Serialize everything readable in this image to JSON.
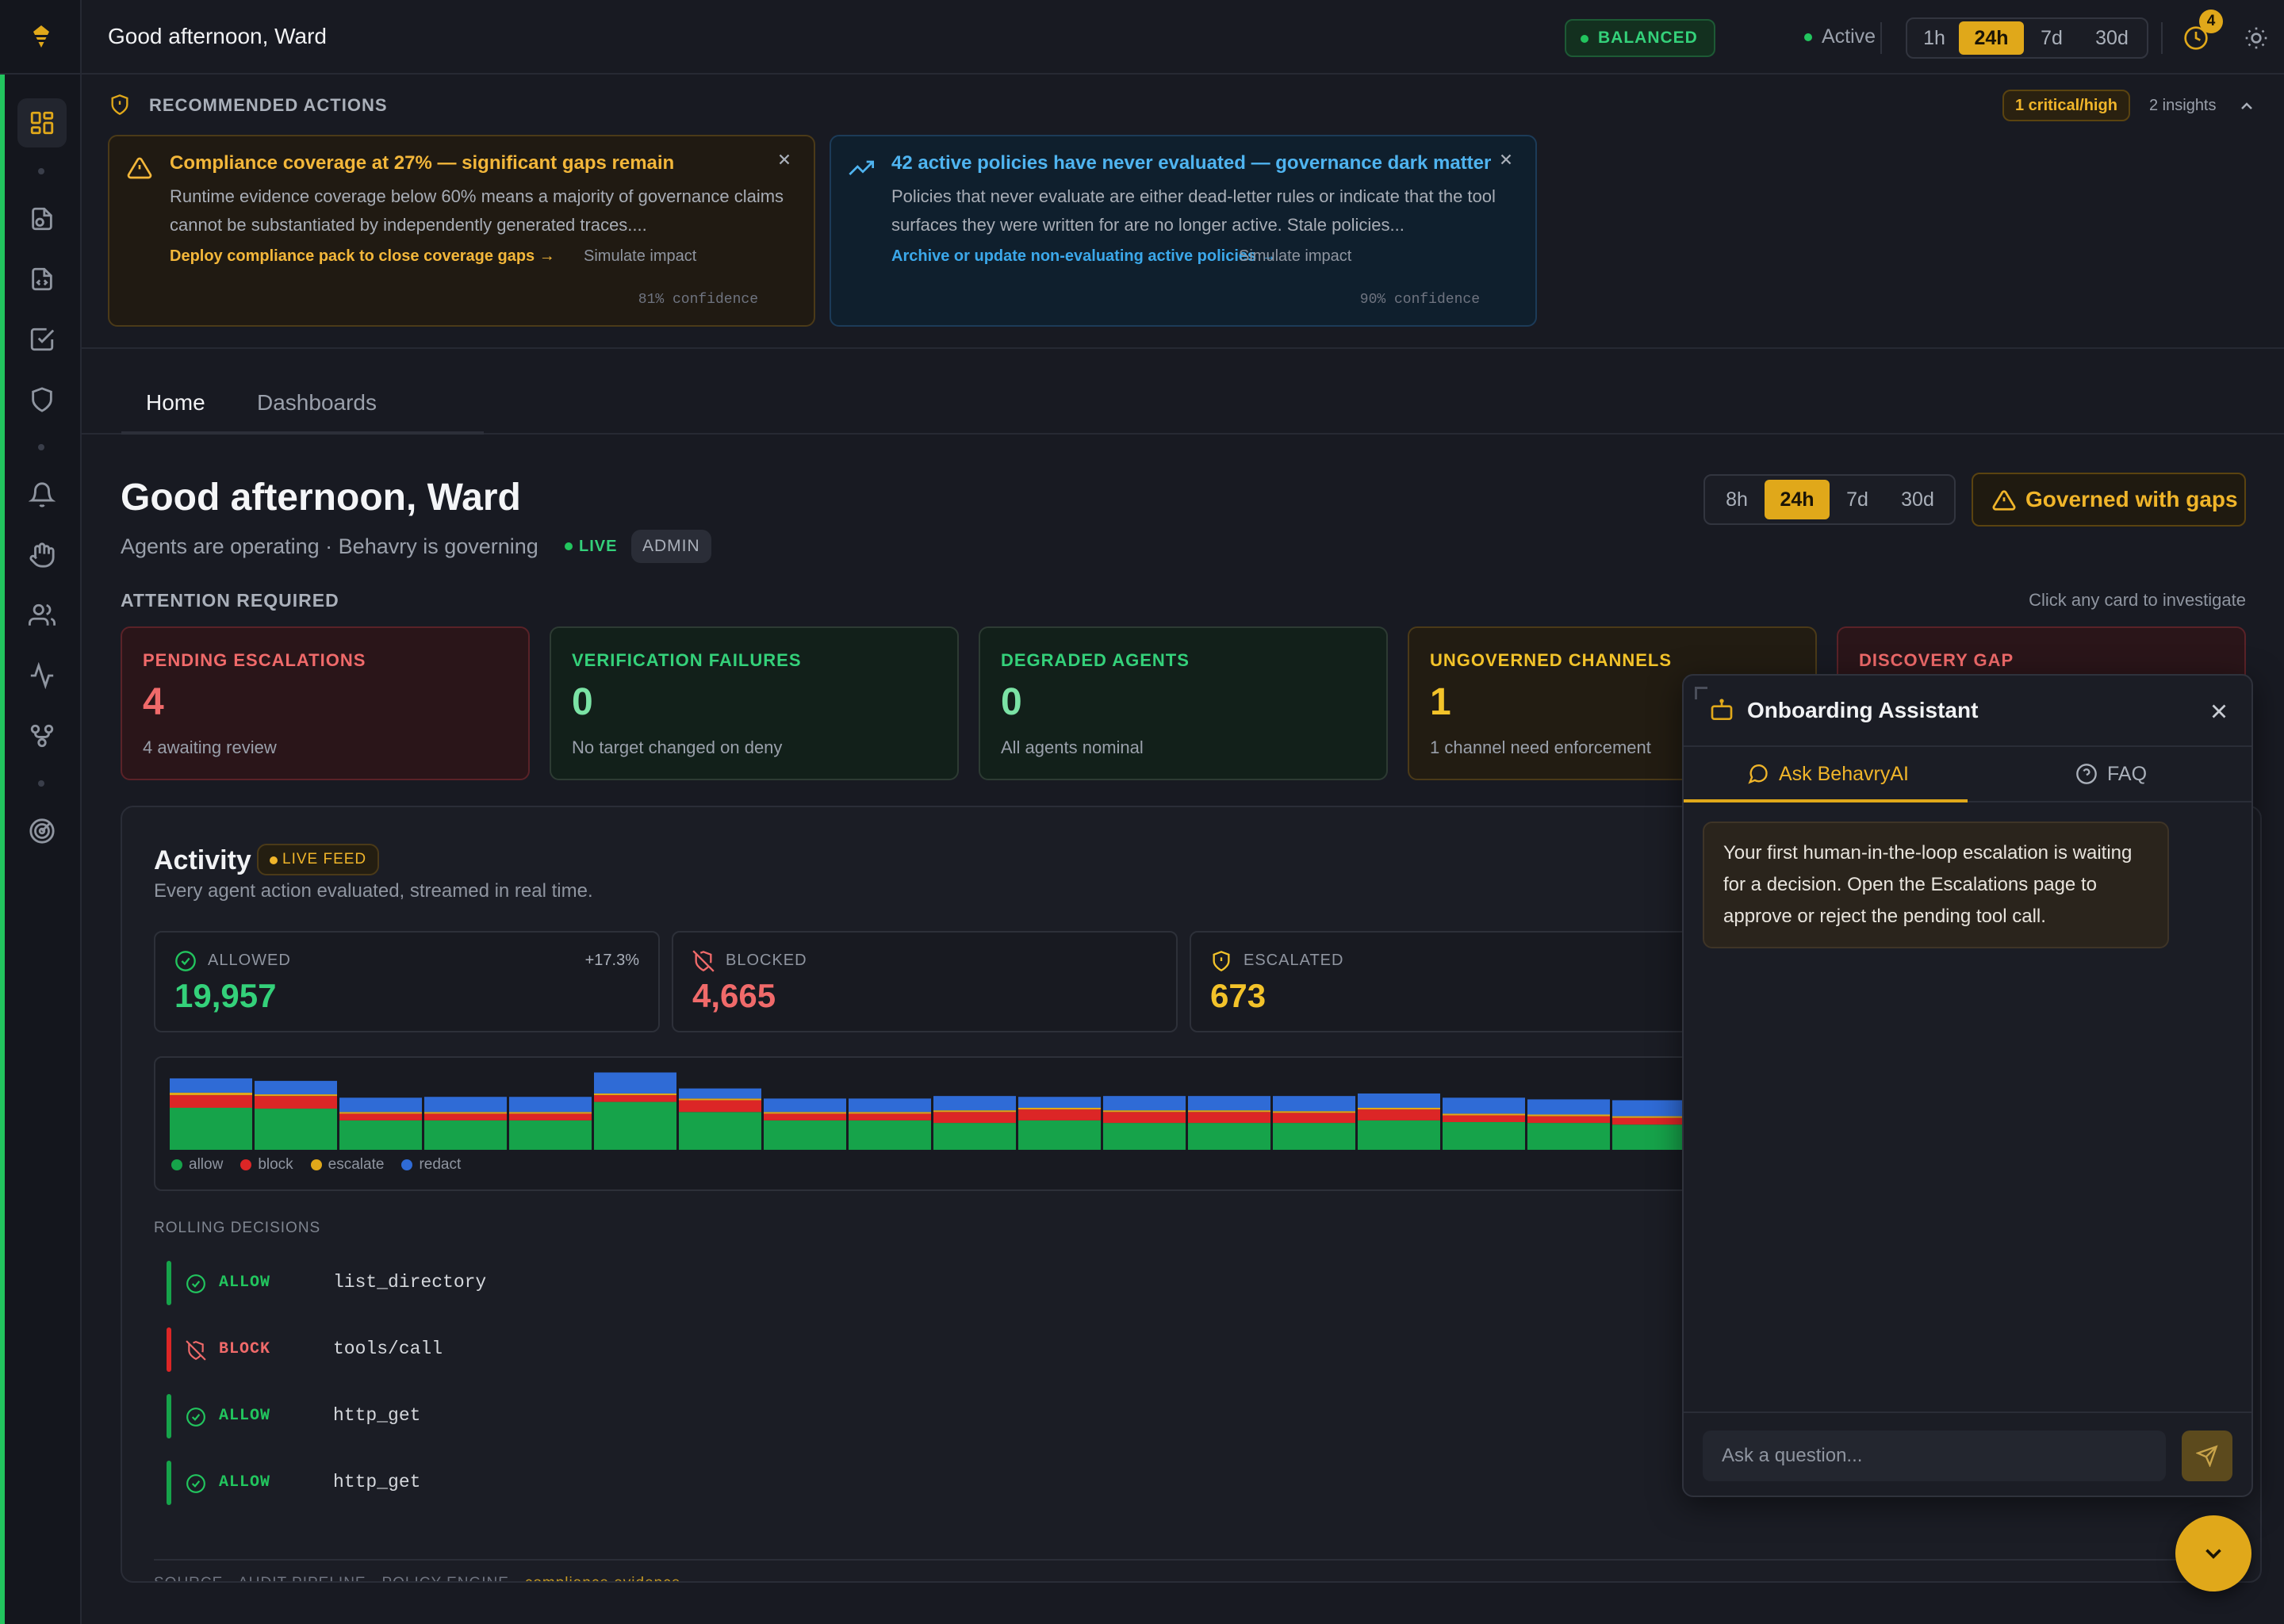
{
  "topbar": {
    "greeting": "Good afternoon, Ward",
    "mode_badge": "BALANCED",
    "status": "Active",
    "ranges": [
      "1h",
      "24h",
      "7d",
      "30d"
    ],
    "selected_range": "24h",
    "notifications_count": "4"
  },
  "recommended": {
    "title": "RECOMMENDED ACTIONS",
    "critical_badge": "1 critical/high",
    "insights": "2 insights",
    "cards": [
      {
        "title": "Compliance coverage at 27% — significant gaps remain",
        "description": "Runtime evidence coverage below 60% means a majority of governance claims cannot be substantiated by independently generated traces....",
        "action": "Deploy compliance pack to close coverage gaps →",
        "simulate": "Simulate impact",
        "confidence": "81% confidence"
      },
      {
        "title": "42 active policies have never evaluated — governance dark matter",
        "description": "Policies that never evaluate are either dead-letter rules or indicate that the tool surfaces they were written for are no longer active. Stale policies...",
        "action": "Archive or update non-evaluating active policies →",
        "simulate": "Simulate impact",
        "confidence": "90% confidence"
      }
    ]
  },
  "tabs": [
    "Home",
    "Dashboards"
  ],
  "header": {
    "title": "Good afternoon, Ward",
    "subtitle": "Agents are operating · Behavry is governing",
    "live": "LIVE",
    "role": "ADMIN",
    "ranges": [
      "8h",
      "24h",
      "7d",
      "30d"
    ],
    "selected_range": "24h",
    "governance_status": "Governed with gaps"
  },
  "attention": {
    "title": "ATTENTION REQUIRED",
    "hint": "Click any card to investigate",
    "cards": [
      {
        "label": "PENDING ESCALATIONS",
        "value": "4",
        "sub": "4 awaiting review"
      },
      {
        "label": "VERIFICATION FAILURES",
        "value": "0",
        "sub": "No target changed on deny"
      },
      {
        "label": "DEGRADED AGENTS",
        "value": "0",
        "sub": "All agents nominal"
      },
      {
        "label": "UNGOVERNED CHANNELS",
        "value": "1",
        "sub": "1 channel need enforcement"
      },
      {
        "label": "DISCOVERY GAP",
        "value": "",
        "sub": ""
      }
    ]
  },
  "activity": {
    "title": "Activity",
    "badge": "LIVE FEED",
    "subtitle": "Every agent action evaluated, streamed in real time.",
    "stats": [
      {
        "label": "ALLOWED",
        "value": "19,957",
        "delta": "+17.3%"
      },
      {
        "label": "BLOCKED",
        "value": "4,665",
        "delta": ""
      },
      {
        "label": "ESCALATED",
        "value": "673",
        "delta": ""
      }
    ],
    "legend": [
      "allow",
      "block",
      "escalate",
      "redact"
    ],
    "colors": {
      "allow": "#16a34a",
      "block": "#dc2626",
      "escalate": "#e0a81a",
      "redact": "#2f6bd6"
    },
    "rolling_title": "ROLLING DECISIONS",
    "decisions": [
      {
        "verdict": "ALLOW",
        "tool": "list_directory"
      },
      {
        "verdict": "BLOCK",
        "tool": "tools/call"
      },
      {
        "verdict": "ALLOW",
        "tool": "http_get"
      },
      {
        "verdict": "ALLOW",
        "tool": "http_get"
      }
    ],
    "source": "SOURCE · AUDIT PIPELINE · POLICY ENGINE · ",
    "source_highlight": "compliance evidence"
  },
  "chart_data": {
    "type": "bar",
    "stacked": true,
    "categories": [
      "1",
      "2",
      "3",
      "4",
      "5",
      "6",
      "7",
      "8",
      "9",
      "10",
      "11",
      "12",
      "13",
      "14",
      "15",
      "16",
      "17",
      "18",
      "19"
    ],
    "series": [
      {
        "name": "allow",
        "values": [
          50,
          49,
          35,
          35,
          35,
          57,
          45,
          35,
          35,
          32,
          35,
          32,
          32,
          32,
          35,
          33,
          32,
          30,
          30
        ]
      },
      {
        "name": "block",
        "values": [
          15,
          15,
          8,
          8,
          8,
          8,
          14,
          8,
          8,
          13,
          13,
          13,
          13,
          12,
          13,
          8,
          8,
          8,
          10
        ]
      },
      {
        "name": "escalate",
        "values": [
          3,
          2,
          2,
          2,
          2,
          2,
          2,
          2,
          2,
          2,
          2,
          2,
          2,
          2,
          2,
          2,
          2,
          2,
          2
        ]
      },
      {
        "name": "redact",
        "values": [
          17,
          16,
          17,
          18,
          18,
          25,
          12,
          16,
          16,
          17,
          13,
          17,
          17,
          18,
          17,
          19,
          18,
          19,
          15
        ]
      }
    ]
  },
  "assistant": {
    "title": "Onboarding Assistant",
    "tabs": [
      "Ask BehavryAI",
      "FAQ"
    ],
    "message": "Your first human-in-the-loop escalation is waiting for a decision. Open the Escalations page to approve or reject the pending tool call.",
    "placeholder": "Ask a question..."
  }
}
